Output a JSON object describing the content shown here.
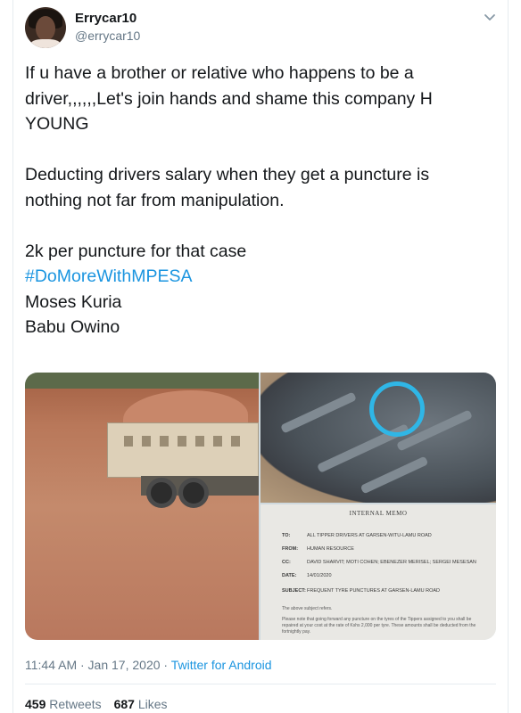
{
  "user": {
    "display_name": "Errycar10",
    "handle": "@errycar10"
  },
  "tweet": {
    "text": "If u have a brother  or relative who happens to be a driver,,,,,,Let's join hands and shame this company H YOUNG\n\nDeducting drivers salary when they get a puncture is nothing not far from manipulation.\n\n2k per puncture for that case\n",
    "hashtag": "#DoMoreWithMPESA",
    "tail": "Moses Kuria\nBabu Owino"
  },
  "memo": {
    "title": "INTERNAL MEMO",
    "rows": [
      {
        "key": "TO:",
        "value": "ALL TIPPER DRIVERS AT GARSEN-WITU-LAMU ROAD"
      },
      {
        "key": "FROM:",
        "value": "HUMAN RESOURCE"
      },
      {
        "key": "CC:",
        "value": "DAVID SHARVIT; MOTI COHEN; EBENEZER MERISEL; SERGEI MESESAN"
      },
      {
        "key": "DATE:",
        "value": "14/01/2020"
      },
      {
        "key": "SUBJECT:",
        "value": "FREQUENT TYRE PUNCTURES AT GARSEN-LAMU ROAD"
      }
    ],
    "body_line1": "The above subject refers.",
    "body_line2": "Please note that going forward any puncture on the tyres of the Tippers assigned to you shall be repaired at your cost at the rate of Kshs 2,000 per tyre. These amounts shall be deducted from the fortnightly pay."
  },
  "meta": {
    "time_date": "11:44 AM · Jan 17, 2020 · ",
    "source": "Twitter for Android"
  },
  "stats": {
    "retweets_count": "459",
    "retweets_label": " Retweets",
    "likes_count": "687",
    "likes_label": " Likes"
  },
  "icons": {
    "caret": "chevron-down-icon"
  },
  "colors": {
    "link": "#1b95e0",
    "secondary_text": "#657786",
    "primary_text": "#14171a",
    "highlight_circle": "#2fb6e6"
  }
}
